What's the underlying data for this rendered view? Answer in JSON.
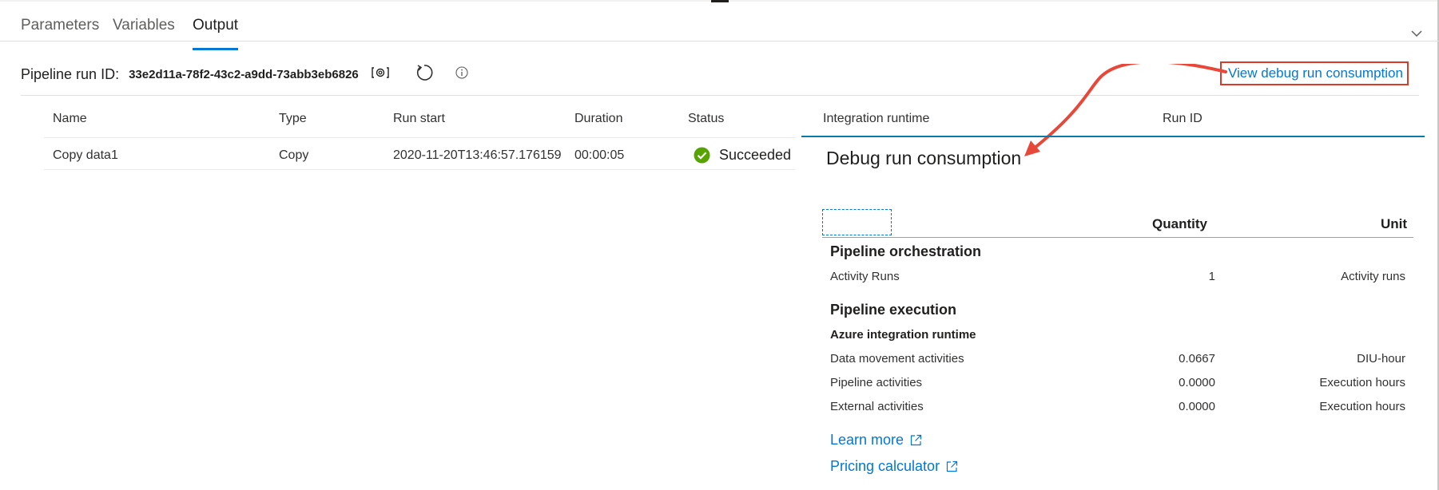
{
  "tabs": [
    {
      "label": "Parameters",
      "active": false
    },
    {
      "label": "Variables",
      "active": false
    },
    {
      "label": "Output",
      "active": true
    }
  ],
  "run": {
    "label": "Pipeline run ID:",
    "id": "33e2d11a-78f2-43c2-a9dd-73abb3eb6826"
  },
  "debug_link": "View debug run consumption",
  "table": {
    "headers": [
      "Name",
      "Type",
      "Run start",
      "Duration",
      "Status",
      "Integration runtime",
      "Run ID"
    ],
    "rows": [
      {
        "name": "Copy data1",
        "type": "Copy",
        "run_start": "2020-11-20T13:46:57.176159",
        "duration": "00:00:05",
        "status": "Succeeded"
      }
    ]
  },
  "consumption": {
    "title": "Debug run consumption",
    "col_quantity": "Quantity",
    "col_unit": "Unit",
    "orchestration": {
      "title": "Pipeline orchestration",
      "items": [
        {
          "name": "Activity Runs",
          "quantity": "1",
          "unit": "Activity runs"
        }
      ]
    },
    "execution": {
      "title": "Pipeline execution",
      "subtitle": "Azure integration runtime",
      "items": [
        {
          "name": "Data movement activities",
          "quantity": "0.0667",
          "unit": "DIU-hour"
        },
        {
          "name": "Pipeline activities",
          "quantity": "0.0000",
          "unit": "Execution hours"
        },
        {
          "name": "External activities",
          "quantity": "0.0000",
          "unit": "Execution hours"
        }
      ]
    },
    "links": {
      "learn_more": "Learn more",
      "pricing": "Pricing calculator"
    }
  },
  "colors": {
    "accent": "#0078d4",
    "success": "#57a300",
    "highlight": "#d83b2a"
  },
  "icons": [
    "copy-icon",
    "refresh-icon",
    "info-icon",
    "success-icon",
    "external-link-icon",
    "chevron-down-icon"
  ]
}
